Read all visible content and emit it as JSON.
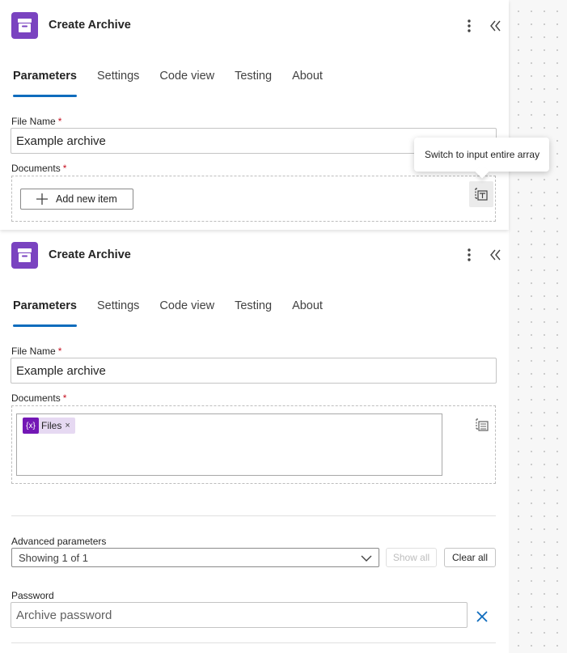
{
  "panels": [
    {
      "title": "Create Archive",
      "tabs": [
        "Parameters",
        "Settings",
        "Code view",
        "Testing",
        "About"
      ],
      "file_name_label": "File Name",
      "required_mark": "*",
      "file_name_value": "Example archive",
      "documents_label": "Documents",
      "add_item_label": "Add new item",
      "tooltip": "Switch to input entire array"
    },
    {
      "title": "Create Archive",
      "tabs": [
        "Parameters",
        "Settings",
        "Code view",
        "Testing",
        "About"
      ],
      "file_name_label": "File Name",
      "required_mark": "*",
      "file_name_value": "Example archive",
      "documents_label": "Documents",
      "token_icon": "{x}",
      "token_label": "Files",
      "token_remove": "×",
      "advanced_label": "Advanced parameters",
      "advanced_select": "Showing 1 of 1",
      "show_all": "Show all",
      "clear_all": "Clear all",
      "password_label": "Password",
      "password_placeholder": "Archive password"
    }
  ],
  "colors": {
    "accent": "#0f6cbd",
    "app_icon": "#7a43c0",
    "token": "#7317b5",
    "required": "#c50f1f"
  },
  "icons": {
    "app": "archive-icon",
    "more": "more-vertical-icon",
    "collapse": "double-chevron-left-icon",
    "add": "plus-icon",
    "array": "array-input-icon",
    "dropdown": "chevron-down-icon",
    "clear": "close-icon"
  }
}
